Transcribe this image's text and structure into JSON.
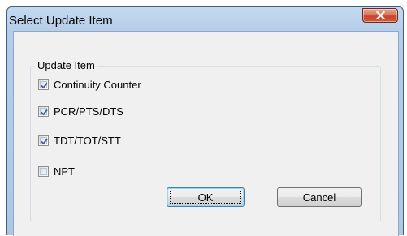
{
  "window": {
    "title": "Select Update Item"
  },
  "icons": {
    "close": "close-icon",
    "check": "checkmark-icon"
  },
  "colors": {
    "title_bar": "#b5cde8",
    "close_button": "#c7452b",
    "client_background": "#f0f0f0",
    "default_button_border": "#3c7fb1"
  },
  "group": {
    "caption": "Update Item",
    "items": [
      {
        "label": "Continuity Counter",
        "checked": true
      },
      {
        "label": "PCR/PTS/DTS",
        "checked": true
      },
      {
        "label": "TDT/TOT/STT",
        "checked": true
      },
      {
        "label": "NPT",
        "checked": false
      }
    ]
  },
  "buttons": {
    "ok_label": "OK",
    "cancel_label": "Cancel"
  }
}
